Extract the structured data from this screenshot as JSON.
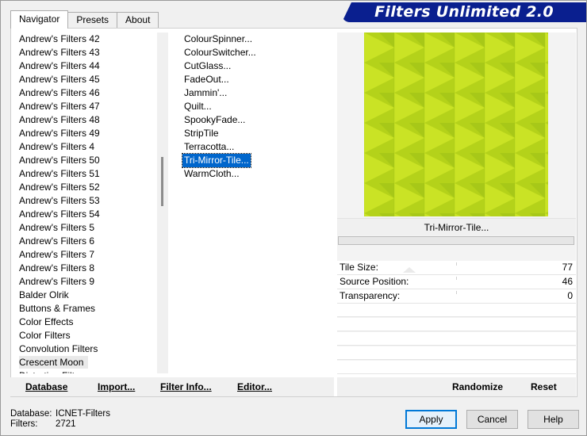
{
  "window": {
    "title_banner": "Filters Unlimited 2.0",
    "tabs": [
      {
        "label": "Navigator",
        "active": true
      },
      {
        "label": "Presets",
        "active": false
      },
      {
        "label": "About",
        "active": false
      }
    ]
  },
  "categories": {
    "items": [
      "Andrew's Filters 42",
      "Andrew's Filters 43",
      "Andrew's Filters 44",
      "Andrew's Filters 45",
      "Andrew's Filters 46",
      "Andrew's Filters 47",
      "Andrew's Filters 48",
      "Andrew's Filters 49",
      "Andrew's Filters 4",
      "Andrew's Filters 50",
      "Andrew's Filters 51",
      "Andrew's Filters 52",
      "Andrew's Filters 53",
      "Andrew's Filters 54",
      "Andrew's Filters 5",
      "Andrew's Filters 6",
      "Andrew's Filters 7",
      "Andrew's Filters 8",
      "Andrew's Filters 9",
      "Balder Olrik",
      "Buttons & Frames",
      "Color Effects",
      "Color Filters",
      "Convolution Filters",
      "Crescent Moon",
      "Distortion Filters"
    ],
    "selected_index": 24
  },
  "filters": {
    "items": [
      "ColourSpinner...",
      "ColourSwitcher...",
      "CutGlass...",
      "FadeOut...",
      "Jammin'...",
      "Quilt...",
      "SpookyFade...",
      "StripTile",
      "Terracotta...",
      "Tri-Mirror-Tile...",
      "WarmCloth..."
    ],
    "selected_index": 9
  },
  "preview": {
    "filter_name": "Tri-Mirror-Tile...",
    "colors": {
      "base": "#b4d21a",
      "light": "#d2e82a",
      "dark": "#9cc018"
    }
  },
  "parameters": [
    {
      "label": "Tile Size:",
      "value": "77"
    },
    {
      "label": "Source Position:",
      "value": "46"
    },
    {
      "label": "Transparency:",
      "value": "0"
    }
  ],
  "toolbar": {
    "database_label": "Database",
    "import_label": "Import...",
    "filter_info_label": "Filter Info...",
    "editor_label": "Editor...",
    "randomize_label": "Randomize",
    "reset_label": "Reset"
  },
  "status": {
    "database_label": "Database:",
    "database_value": "ICNET-Filters",
    "filters_label": "Filters:",
    "filters_value": "2721"
  },
  "dialog": {
    "apply_label": "Apply",
    "cancel_label": "Cancel",
    "help_label": "Help"
  }
}
